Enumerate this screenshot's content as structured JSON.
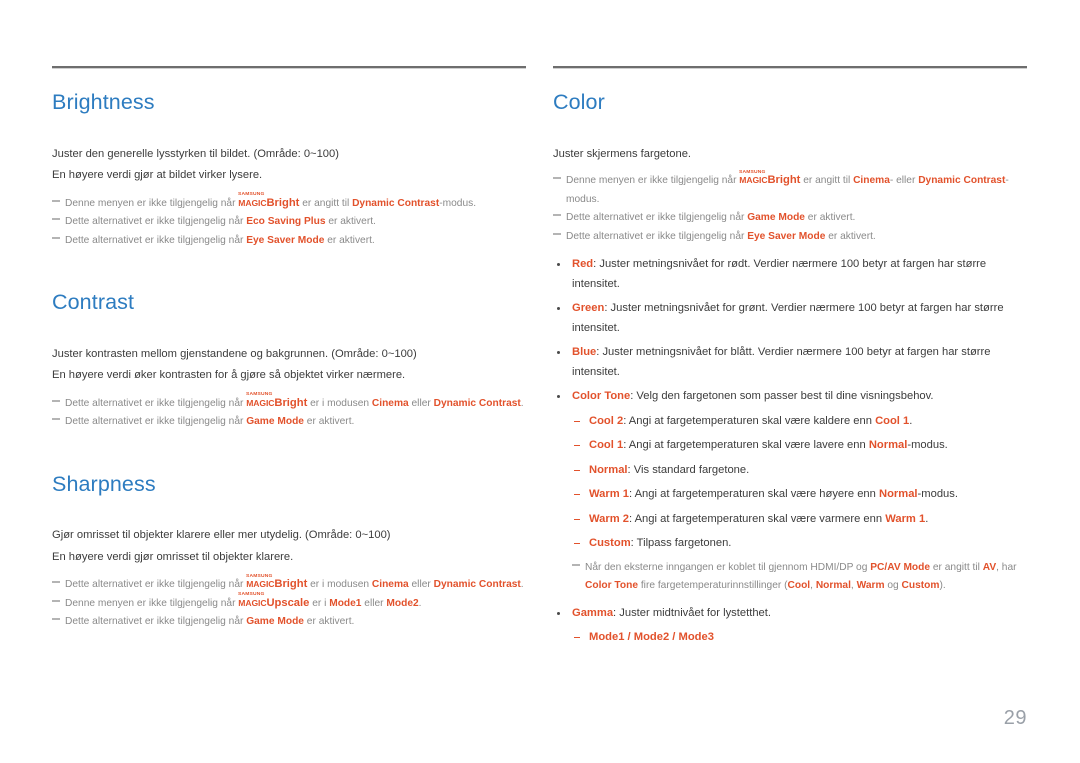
{
  "page": {
    "number": "29",
    "accent_heading_color": "#2d7cc0",
    "highlight_color": "#e2522c",
    "body_color": "#3c3c3c",
    "note_color": "#8a8a8a"
  },
  "logo": {
    "samsung": "SAMSUNG",
    "magic": "MAGIC",
    "bright_suffix": "Bright",
    "upscale_suffix": "Upscale"
  },
  "left_column": {
    "sections": [
      {
        "title": "Brightness",
        "paragraphs": [
          "Juster den generelle lysstyrken til bildet. (Område: 0~100)",
          "En høyere verdi gjør at bildet virker lysere."
        ],
        "notes": [
          {
            "pre": "Denne menyen er ikke tilgjengelig når ",
            "logo": "Bright",
            "mid": " er angitt til ",
            "term1": "Dynamic Contrast",
            "post": "-modus."
          },
          {
            "pre": "Dette alternativet er ikke tilgjengelig når ",
            "term1": "Eco Saving Plus",
            "post": " er aktivert."
          },
          {
            "pre": "Dette alternativet er ikke tilgjengelig når ",
            "term1": "Eye Saver Mode",
            "post": " er aktivert."
          }
        ]
      },
      {
        "title": "Contrast",
        "paragraphs": [
          "Juster kontrasten mellom gjenstandene og bakgrunnen. (Område: 0~100)",
          "En høyere verdi øker kontrasten for å gjøre så objektet virker nærmere."
        ],
        "notes": [
          {
            "pre": "Dette alternativet er ikke tilgjengelig når ",
            "logo": "Bright",
            "mid": " er i modusen ",
            "term1": "Cinema",
            "conj": " eller ",
            "term2": "Dynamic Contrast",
            "post": "."
          },
          {
            "pre": "Dette alternativet er ikke tilgjengelig når ",
            "term1": "Game Mode",
            "post": " er aktivert."
          }
        ]
      },
      {
        "title": "Sharpness",
        "paragraphs": [
          "Gjør omrisset til objekter klarere eller mer utydelig. (Område: 0~100)",
          "En høyere verdi gjør omrisset til objekter klarere."
        ],
        "notes": [
          {
            "pre": "Dette alternativet er ikke tilgjengelig når ",
            "logo": "Bright",
            "mid": " er i modusen ",
            "term1": "Cinema",
            "conj": " eller ",
            "term2": "Dynamic Contrast",
            "post": "."
          },
          {
            "pre": "Denne menyen er ikke tilgjengelig når ",
            "logo": "Upscale",
            "mid": " er i ",
            "term1": "Mode1",
            "conj": " eller ",
            "term2": "Mode2",
            "post": "."
          },
          {
            "pre": "Dette alternativet er ikke tilgjengelig når ",
            "term1": "Game Mode",
            "post": " er aktivert."
          }
        ]
      }
    ]
  },
  "right_column": {
    "section": {
      "title": "Color",
      "intro": "Juster skjermens fargetone.",
      "notes": [
        {
          "pre": "Denne menyen er ikke tilgjengelig når ",
          "logo": "Bright",
          "mid": " er angitt til ",
          "term1": "Cinema",
          "conj": "- eller ",
          "term2": "Dynamic Contrast",
          "post": "-modus."
        },
        {
          "pre": "Dette alternativet er ikke tilgjengelig når ",
          "term1": "Game Mode",
          "post": " er aktivert."
        },
        {
          "pre": "Dette alternativet er ikke tilgjengelig når ",
          "term1": "Eye Saver Mode",
          "post": " er aktivert."
        }
      ],
      "bullets": [
        {
          "term": "Red",
          "text": ": Juster metningsnivået for rødt. Verdier nærmere 100 betyr at fargen har større intensitet."
        },
        {
          "term": "Green",
          "text": ": Juster metningsnivået for grønt. Verdier nærmere 100 betyr at fargen har større intensitet."
        },
        {
          "term": "Blue",
          "text": ": Juster metningsnivået for blått. Verdier nærmere 100 betyr at fargen har større intensitet."
        },
        {
          "term": "Color Tone",
          "text": ": Velg den fargetonen som passer best til dine visningsbehov."
        }
      ],
      "color_tone_items": [
        {
          "term": "Cool 2",
          "mid": ": Angi at fargetemperaturen skal være kaldere enn ",
          "term2": "Cool 1",
          "post": "."
        },
        {
          "term": "Cool 1",
          "mid": ": Angi at fargetemperaturen skal være lavere enn ",
          "term2": "Normal",
          "post": "-modus."
        },
        {
          "term": "Normal",
          "mid": ": Vis standard fargetone.",
          "term2": "",
          "post": ""
        },
        {
          "term": "Warm 1",
          "mid": ": Angi at fargetemperaturen skal være høyere enn ",
          "term2": "Normal",
          "post": "-modus."
        },
        {
          "term": "Warm 2",
          "mid": ": Angi at fargetemperaturen skal være varmere enn ",
          "term2": "Warm 1",
          "post": "."
        },
        {
          "term": "Custom",
          "mid": ": Tilpass fargetonen.",
          "term2": "",
          "post": ""
        }
      ],
      "external_note": {
        "p1": "Når den eksterne inngangen er koblet til gjennom HDMI/DP og ",
        "t1": "PC/AV Mode",
        "p2": " er angitt til ",
        "t2": "AV",
        "p3": ", har ",
        "t3": "Color Tone",
        "p4": " fire fargetemperaturinnstillinger (",
        "t4": "Cool",
        "p5": ", ",
        "t5": "Normal",
        "p6": ", ",
        "t6": "Warm",
        "p7": " og ",
        "t7": "Custom",
        "p8": ")."
      },
      "gamma_bullet": {
        "term": "Gamma",
        "text": ": Juster midtnivået for lystetthet."
      },
      "gamma_modes": "Mode1 / Mode2 / Mode3"
    }
  }
}
